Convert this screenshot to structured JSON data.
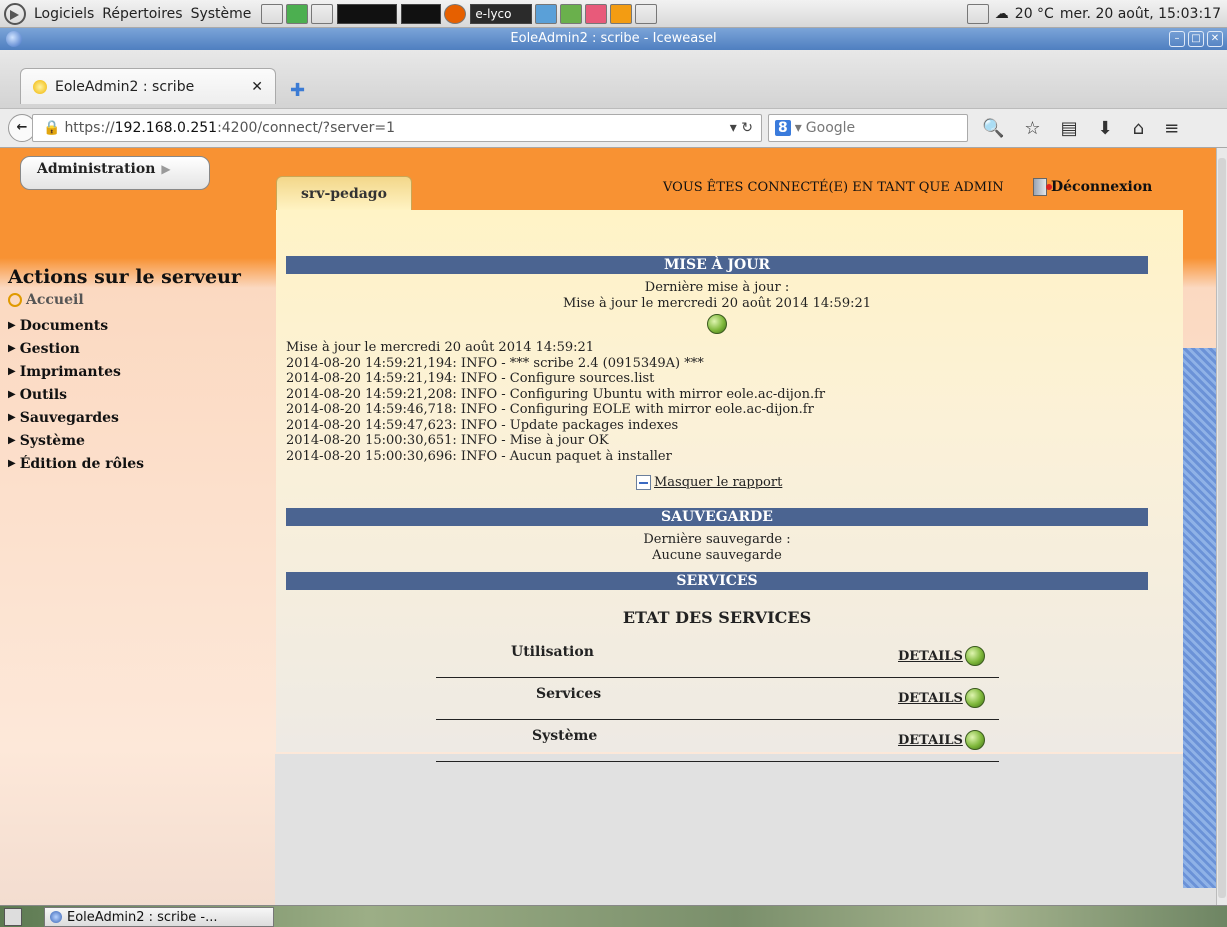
{
  "panel": {
    "menus": [
      "Logiciels",
      "Répertoires",
      "Système"
    ],
    "task_label": "e-lyco",
    "weather": "20 °C",
    "datetime": "mer. 20 août, 15:03:17"
  },
  "window": {
    "title": "EoleAdmin2 : scribe - Iceweasel"
  },
  "tabs": [
    {
      "label": "EoleAdmin2 : scribe"
    }
  ],
  "navbar": {
    "url_prefix": "https://",
    "url_host": "192.168.0.251",
    "url_rest": ":4200/connect/?server=1",
    "search_placeholder": "Google"
  },
  "header": {
    "admin_button": "Administration",
    "server_tab": "srv-pedago",
    "connected_as": "VOUS ÊTES CONNECTÉ(E) EN TANT QUE ADMIN",
    "logout": "Déconnexion"
  },
  "sidebar": {
    "title": "Actions sur le serveur",
    "home": "Accueil",
    "items": [
      "Documents",
      "Gestion",
      "Imprimantes",
      "Outils",
      "Sauvegardes",
      "Système",
      "Édition de rôles"
    ]
  },
  "update": {
    "title": "MISE À JOUR",
    "last_label": "Dernière mise à jour :",
    "last_value": "Mise à jour le mercredi 20 août 2014 14:59:21",
    "log": [
      "Mise à jour le mercredi 20 août 2014 14:59:21",
      "2014-08-20 14:59:21,194: INFO - *** scribe 2.4 (0915349A) ***",
      "2014-08-20 14:59:21,194: INFO - Configure sources.list",
      "2014-08-20 14:59:21,208: INFO - Configuring Ubuntu with mirror eole.ac-dijon.fr",
      "2014-08-20 14:59:46,718: INFO - Configuring EOLE with mirror eole.ac-dijon.fr",
      "2014-08-20 14:59:47,623: INFO - Update packages indexes",
      "2014-08-20 15:00:30,651: INFO - Mise à jour OK",
      "2014-08-20 15:00:30,696: INFO - Aucun paquet à installer"
    ],
    "hide_report": "Masquer le rapport"
  },
  "backup": {
    "title": "SAUVEGARDE",
    "last_label": "Dernière sauvegarde :",
    "last_value": "Aucune sauvegarde"
  },
  "services": {
    "title": "SERVICES",
    "subtitle": "ETAT DES SERVICES",
    "rows": [
      {
        "name": "Utilisation",
        "details": "DETAILS"
      },
      {
        "name": "Services",
        "details": "DETAILS"
      },
      {
        "name": "Système",
        "details": "DETAILS"
      }
    ]
  },
  "taskbar": {
    "task": "EoleAdmin2 : scribe -..."
  }
}
